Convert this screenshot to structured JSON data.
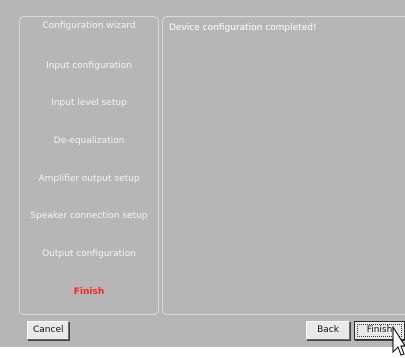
{
  "wizard": {
    "steps": [
      {
        "label": "Configuration wizard"
      },
      {
        "label": "Input configuration"
      },
      {
        "label": "Input level setup"
      },
      {
        "label": "De-equalization"
      },
      {
        "label": "Amplifier output setup"
      },
      {
        "label": "Speaker connection setup"
      },
      {
        "label": "Output configuration"
      },
      {
        "label": "Finish",
        "active": true
      }
    ],
    "message": "Device configuration completed!"
  },
  "buttons": {
    "cancel": "Cancel",
    "back": "Back",
    "finish": "Finish"
  },
  "colors": {
    "background": "#b6b6b6",
    "step_text": "#f3f3f3",
    "active_step": "#ff1f1f"
  }
}
